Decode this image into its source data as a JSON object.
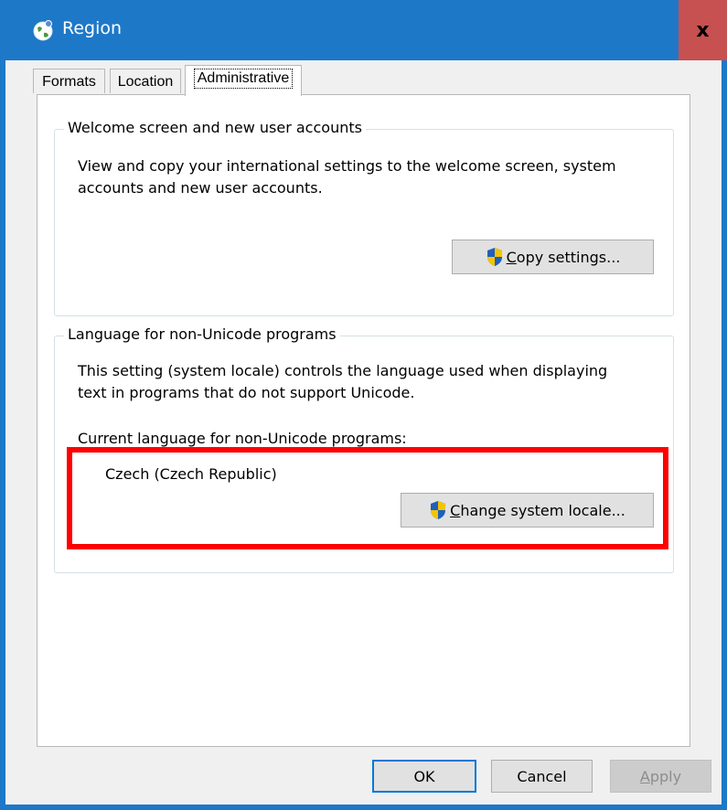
{
  "window": {
    "title": "Region",
    "close_label": "x"
  },
  "tabs": [
    {
      "label": "Formats",
      "active": false
    },
    {
      "label": "Location",
      "active": false
    },
    {
      "label": "Administrative",
      "active": true
    }
  ],
  "welcome_group": {
    "legend": "Welcome screen and new user accounts",
    "description_line1": "View and copy your international settings to the welcome screen, system",
    "description_line2": "accounts and new user accounts.",
    "copy_button_prefix": "C",
    "copy_button_rest": "opy settings..."
  },
  "language_group": {
    "legend": "Language for non-Unicode programs",
    "description_line1": "This setting (system locale) controls the language used when displaying",
    "description_line2": "text in programs that do not support Unicode.",
    "current_label": "Current language for non-Unicode programs:",
    "current_value": "Czech (Czech Republic)",
    "change_button_prefix": "C",
    "change_button_rest": "hange system locale..."
  },
  "footer": {
    "ok_label": "OK",
    "cancel_label": "Cancel",
    "apply_prefix": "A",
    "apply_rest": "pply"
  },
  "colors": {
    "title_bar": "#1e78c8",
    "close_button": "#c75050",
    "highlight": "#ff0000",
    "shield_blue": "#1f5fbf",
    "shield_yellow": "#f5c400"
  },
  "icons": {
    "title": "globe-icon",
    "shield": "uac-shield-icon"
  }
}
